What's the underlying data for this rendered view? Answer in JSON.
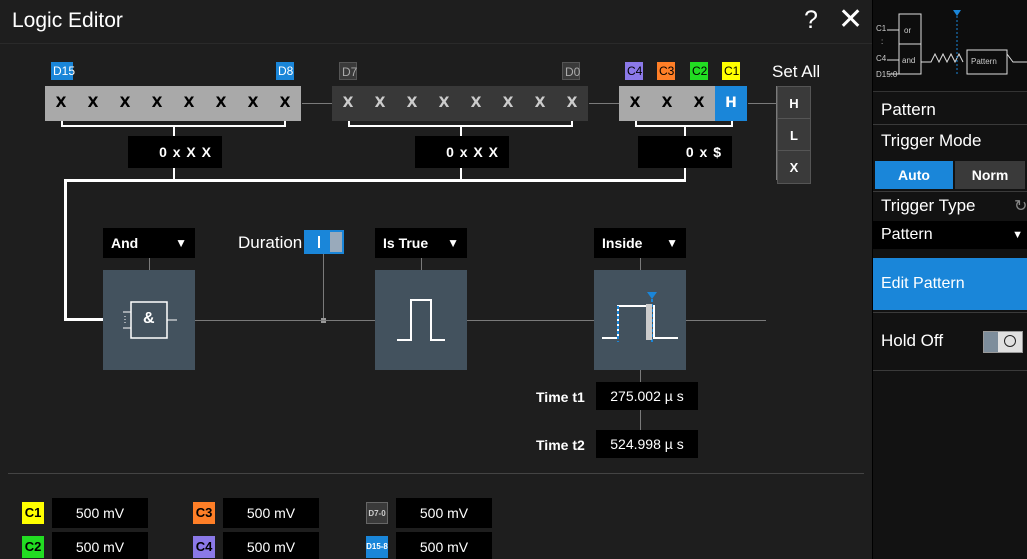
{
  "window": {
    "title": "Logic Editor",
    "help": "?",
    "close": "✕"
  },
  "channel_tags": {
    "d15": "D15",
    "d8": "D8",
    "d7": "D7",
    "d0": "D0",
    "c4": "C4",
    "c3": "C3",
    "c2": "C2",
    "c1": "C1"
  },
  "bits": {
    "group1": [
      "X",
      "X",
      "X",
      "X",
      "X",
      "X",
      "X",
      "X"
    ],
    "group2": [
      "X",
      "X",
      "X",
      "X",
      "X",
      "X",
      "X",
      "X"
    ],
    "group3": [
      "X",
      "X",
      "X",
      "H"
    ]
  },
  "hex": {
    "group1": "0 x X X",
    "group2": "0 x X X",
    "group3": "0 x $"
  },
  "set_all": {
    "label": "Set All",
    "high": "H",
    "low": "L",
    "dont_care": "X"
  },
  "logic": {
    "op": "And",
    "symbol": "&"
  },
  "duration": {
    "label": "Duration",
    "enabled": true
  },
  "condition": {
    "value": "Is True"
  },
  "range": {
    "value": "Inside"
  },
  "times": {
    "t1_label": "Time t1",
    "t1_value": "275.002 µ s",
    "t2_label": "Time t2",
    "t2_value": "524.998 µ s"
  },
  "channels": [
    {
      "tag": "C1",
      "value": "500 mV",
      "color": "#ffff00"
    },
    {
      "tag": "C3",
      "value": "500 mV",
      "color": "#ff7f27"
    },
    {
      "tag": "D7-0",
      "value": "500 mV",
      "color": "#3a3a3a"
    },
    {
      "tag": "C2",
      "value": "500 mV",
      "color": "#22dd22"
    },
    {
      "tag": "C4",
      "value": "500 mV",
      "color": "#8b79e8"
    },
    {
      "tag": "D15-8",
      "value": "500 mV",
      "color": "#1a86d9"
    }
  ],
  "sidebar": {
    "thumb": {
      "c1": "C1",
      "c4": "C4",
      "d": "D15:0",
      "or": "or",
      "and": "and",
      "pattern": "Pattern",
      "dots": ":"
    },
    "section": "Pattern",
    "trigger_mode": {
      "label": "Trigger Mode",
      "auto": "Auto",
      "norm": "Norm",
      "selected": "Auto"
    },
    "trigger_type": {
      "label": "Trigger Type",
      "value": "Pattern"
    },
    "edit_pattern": "Edit Pattern",
    "hold_off": {
      "label": "Hold Off",
      "enabled": false
    }
  }
}
